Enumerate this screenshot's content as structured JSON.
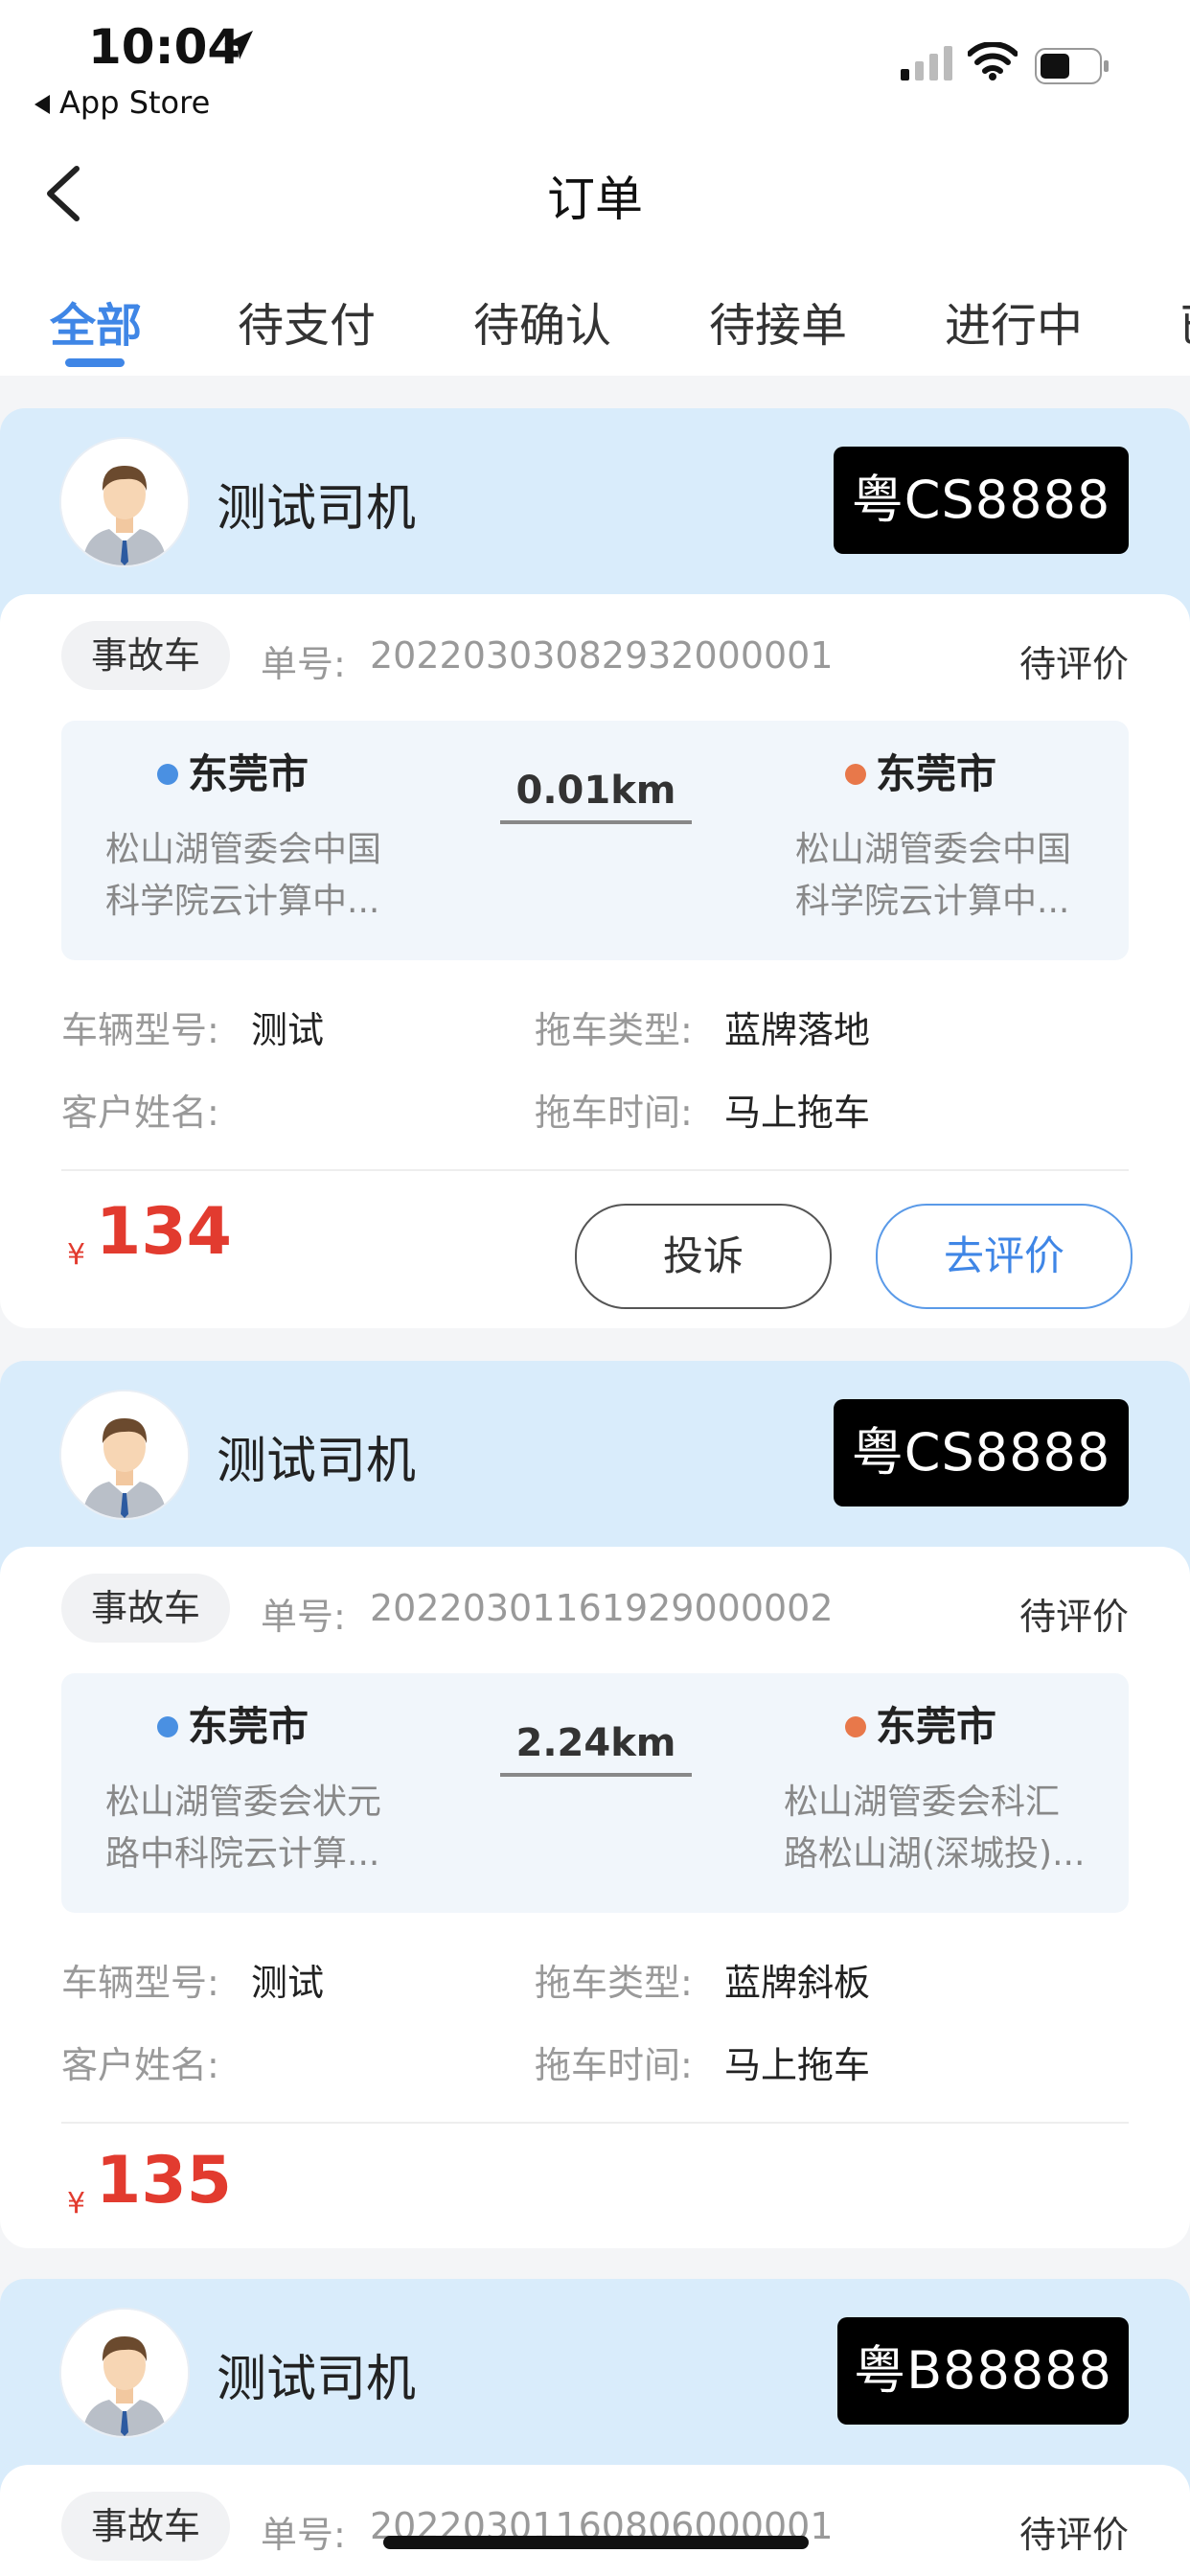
{
  "status_bar": {
    "time": "10:04",
    "back_app": "App Store"
  },
  "nav": {
    "title": "订单"
  },
  "tabs": [
    {
      "label": "全部",
      "active": true
    },
    {
      "label": "待支付",
      "active": false
    },
    {
      "label": "待确认",
      "active": false
    },
    {
      "label": "待接单",
      "active": false
    },
    {
      "label": "进行中",
      "active": false
    },
    {
      "label": "已",
      "active": false
    }
  ],
  "labels": {
    "order_no": "单号:",
    "vehicle_model": "车辆型号:",
    "tow_type": "拖车类型:",
    "customer_name": "客户姓名:",
    "tow_time": "拖车时间:",
    "currency": "¥",
    "complain": "投诉",
    "review": "去评价"
  },
  "colors": {
    "accent": "#3f86e6",
    "price": "#e23b2f",
    "origin_dot": "#4a90e2",
    "dest_dot": "#e8784a",
    "header_bg": "#d9ecfb"
  },
  "orders": [
    {
      "driver": "测试司机",
      "plate": "粤CS8888",
      "tag": "事故车",
      "order_no": "20220303082932000001",
      "status": "待评价",
      "origin_city": "东莞市",
      "origin_addr_1": "松山湖管委会中国",
      "origin_addr_2": "科学院云计算中...",
      "distance": "0.01km",
      "dest_city": "东莞市",
      "dest_addr_1": "松山湖管委会中国",
      "dest_addr_2": "科学院云计算中...",
      "vehicle_model": "测试",
      "tow_type": "蓝牌落地",
      "customer_name": "",
      "tow_time": "马上拖车",
      "price": "134"
    },
    {
      "driver": "测试司机",
      "plate": "粤CS8888",
      "tag": "事故车",
      "order_no": "20220301161929000002",
      "status": "待评价",
      "origin_city": "东莞市",
      "origin_addr_1": "松山湖管委会状元",
      "origin_addr_2": "路中科院云计算...",
      "distance": "2.24km",
      "dest_city": "东莞市",
      "dest_addr_1": "松山湖管委会科汇",
      "dest_addr_2": "路松山湖(深城投)...",
      "vehicle_model": "测试",
      "tow_type": "蓝牌斜板",
      "customer_name": "",
      "tow_time": "马上拖车",
      "price": "135"
    },
    {
      "driver": "测试司机",
      "plate": "粤B88888",
      "tag": "事故车",
      "order_no": "20220301160806000001",
      "status": "待评价"
    }
  ]
}
